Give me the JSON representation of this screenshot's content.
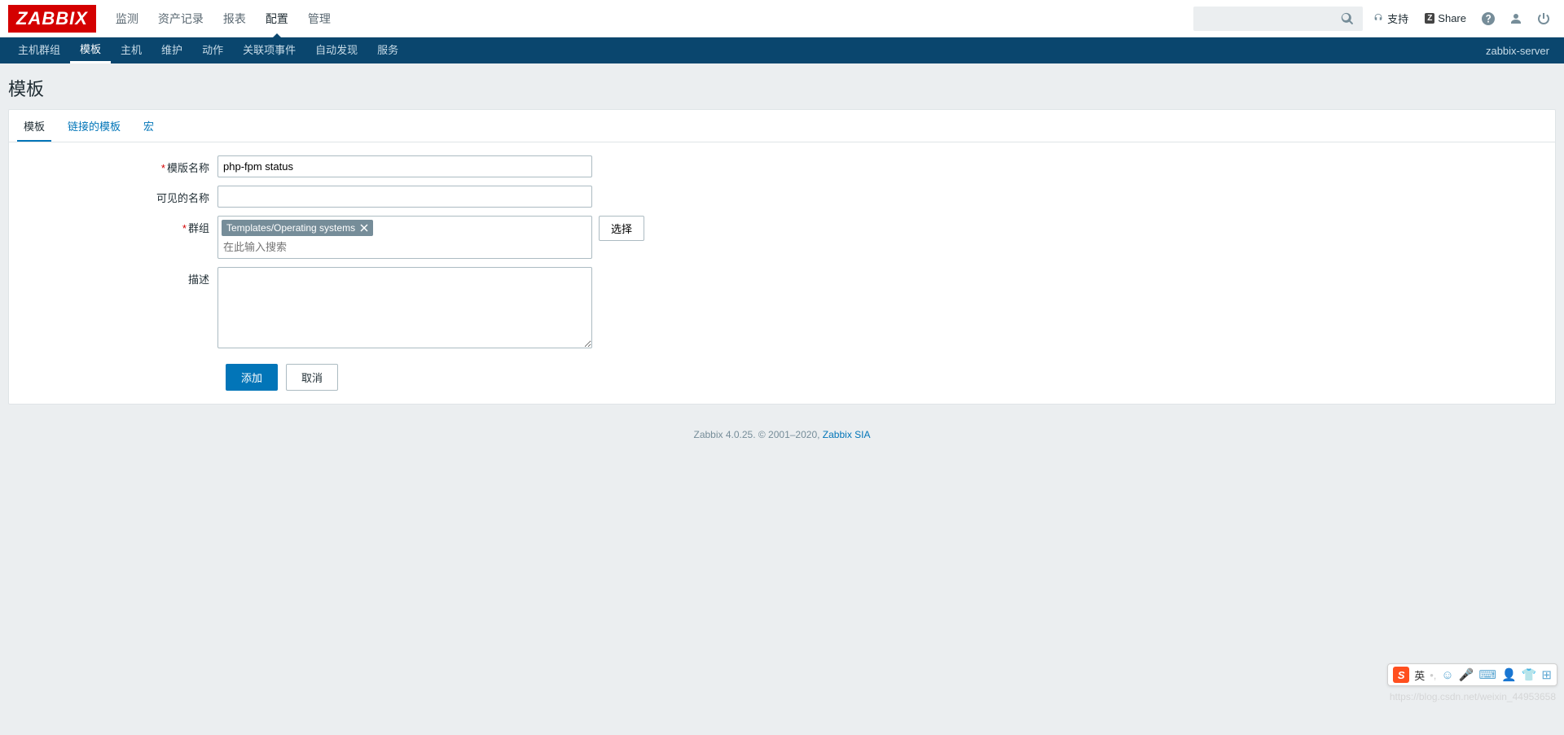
{
  "logo": "ZABBIX",
  "main_nav": [
    "监测",
    "资产记录",
    "报表",
    "配置",
    "管理"
  ],
  "main_nav_active": 3,
  "support_label": "支持",
  "share_label": "Share",
  "sub_nav": [
    "主机群组",
    "模板",
    "主机",
    "维护",
    "动作",
    "关联项事件",
    "自动发现",
    "服务"
  ],
  "sub_nav_active": 1,
  "server_name": "zabbix-server",
  "page_title": "模板",
  "tabs": [
    "模板",
    "链接的模板",
    "宏"
  ],
  "tabs_active": 0,
  "form": {
    "template_name_label": "模版名称",
    "template_name_value": "php-fpm status",
    "visible_name_label": "可见的名称",
    "visible_name_value": "",
    "groups_label": "群组",
    "groups_chip": "Templates/Operating systems",
    "groups_placeholder": "在此输入搜索",
    "groups_select_btn": "选择",
    "description_label": "描述",
    "description_value": "",
    "add_btn": "添加",
    "cancel_btn": "取消"
  },
  "footer": {
    "text": "Zabbix 4.0.25. © 2001–2020, ",
    "link": "Zabbix SIA"
  },
  "watermark": "https://blog.csdn.net/weixin_44953658",
  "ime": {
    "cn": "英"
  }
}
